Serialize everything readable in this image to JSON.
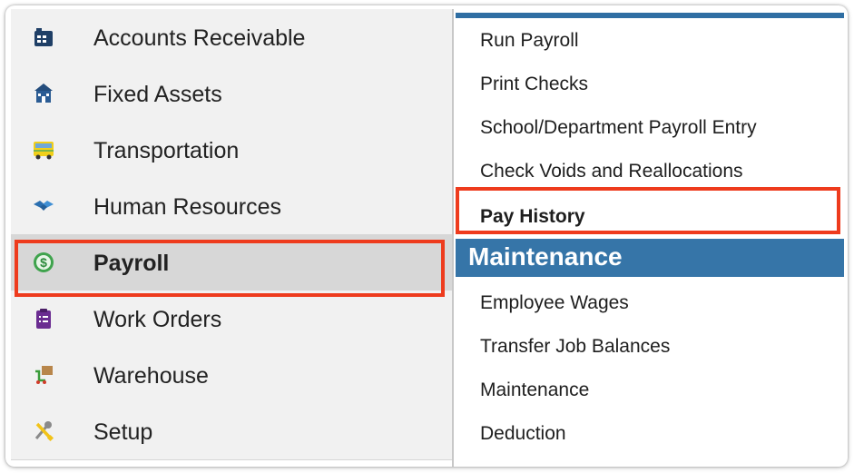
{
  "sidebar": {
    "items": [
      {
        "label": "Accounts Receivable",
        "icon": "ledger-icon"
      },
      {
        "label": "Fixed Assets",
        "icon": "building-icon"
      },
      {
        "label": "Transportation",
        "icon": "bus-icon"
      },
      {
        "label": "Human Resources",
        "icon": "handshake-icon"
      },
      {
        "label": "Payroll",
        "icon": "dollar-coin-icon",
        "active": true
      },
      {
        "label": "Work Orders",
        "icon": "clipboard-icon"
      },
      {
        "label": "Warehouse",
        "icon": "forklift-box-icon"
      },
      {
        "label": "Setup",
        "icon": "wrench-screwdriver-icon"
      }
    ]
  },
  "submenu": {
    "items": [
      "Run Payroll",
      "Print Checks",
      "School/Department Payroll Entry",
      "Check Voids and Reallocations",
      "Pay History"
    ],
    "section_title": "Maintenance",
    "maintenance_items": [
      "Employee Wages",
      "Transfer Job Balances",
      "Maintenance",
      "Deduction"
    ]
  },
  "colors": {
    "accent": "#3675a8",
    "highlight": "#ee3b1d",
    "sidebar_bg": "#f1f1f1",
    "active_bg": "#d7d7d7"
  }
}
